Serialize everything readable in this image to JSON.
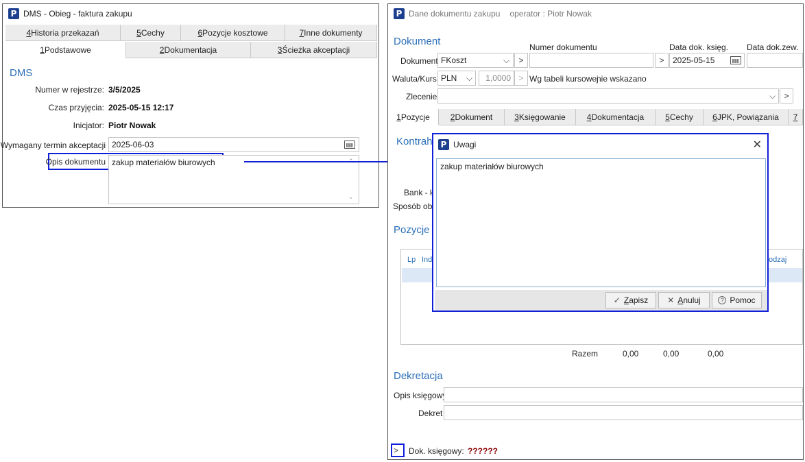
{
  "left_window": {
    "title": "DMS - Obieg - faktura zakupu",
    "tabs_row1": [
      {
        "key": "4",
        "rest": " Historia przekazań"
      },
      {
        "key": "5",
        "rest": " Cechy"
      },
      {
        "key": "6",
        "rest": " Pozycje kosztowe"
      },
      {
        "key": "7",
        "rest": " Inne dokumenty"
      }
    ],
    "tabs_row2": [
      {
        "key": "1",
        "rest": " Podstawowe"
      },
      {
        "key": "2",
        "rest": " Dokumentacja"
      },
      {
        "key": "3",
        "rest": " Ścieżka akceptacji"
      }
    ],
    "section": "DMS",
    "numer_label": "Numer w rejestrze:",
    "numer_value": "3/5/2025",
    "czas_label": "Czas przyjęcia:",
    "czas_value": "2025-05-15 12:17",
    "inicjator_label": "Inicjator:",
    "inicjator_value": "Piotr Nowak",
    "termin_label": "Wymagany termin akceptacji",
    "termin_value": "2025-06-03",
    "opis_label": "Opis dokumentu",
    "opis_value": "zakup materiałów biurowych"
  },
  "right_window": {
    "title": "Dane dokumentu zakupu",
    "operator": "operator : Piotr Nowak",
    "section_dokument": "Dokument",
    "dokument_label": "Dokument",
    "dokument_value": "FKoszt",
    "numer_dok_label": "Numer dokumentu",
    "numer_dok_value": "",
    "data_ksieg_label": "Data dok. księg.",
    "data_ksieg_value": "2025-05-15",
    "data_zew_label": "Data dok.zew.",
    "waluta_label": "Waluta/Kurs",
    "waluta_value": "PLN",
    "kurs_value": "1,0000",
    "wg_tabeli": "Wg tabeli kursowej",
    "nie_wskazano": "nie wskazano",
    "zlecenie_label": "Zlecenie",
    "tabs": [
      {
        "key": "1",
        "rest": " Pozycje"
      },
      {
        "key": "2",
        "rest": " Dokument"
      },
      {
        "key": "3",
        "rest": " Księgowanie"
      },
      {
        "key": "4",
        "rest": " Dokumentacja"
      },
      {
        "key": "5",
        "rest": " Cechy"
      },
      {
        "key": "6",
        "rest": " JPK, Powiązania"
      },
      {
        "key": "7",
        "rest": ""
      }
    ],
    "kontrah_partial": "Kontrah",
    "bank_partial": "Bank - k",
    "sposob_partial": "Sposób obs",
    "section_pozycje": "Pozycje",
    "col_lp": "Lp",
    "col_ind": "Ind",
    "col_rodzaj_partial": "odzaj",
    "razem_label": "Razem",
    "razem_values": [
      "0,00",
      "0,00",
      "0,00"
    ],
    "section_dekretacja": "Dekretacja",
    "opis_ksiegowy_label": "Opis księgowy",
    "dekret_label": "Dekret",
    "dok_ksiegowy_label": "Dok. księgowy:",
    "dok_ksiegowy_value": "??????"
  },
  "dialog": {
    "title": "Uwagi",
    "text": "zakup materiałów biurowych",
    "zapisz_key": "Z",
    "zapisz_rest": "apisz",
    "anuluj_key": "A",
    "anuluj_rest": "nuluj",
    "pomoc_label": "Pomoc"
  },
  "colors": {
    "highlight": "#1020d8",
    "section_blue": "#2b6fb7",
    "app_icon": "#1d3f8f",
    "dok_ksiegowy_value": "#8b0000"
  }
}
